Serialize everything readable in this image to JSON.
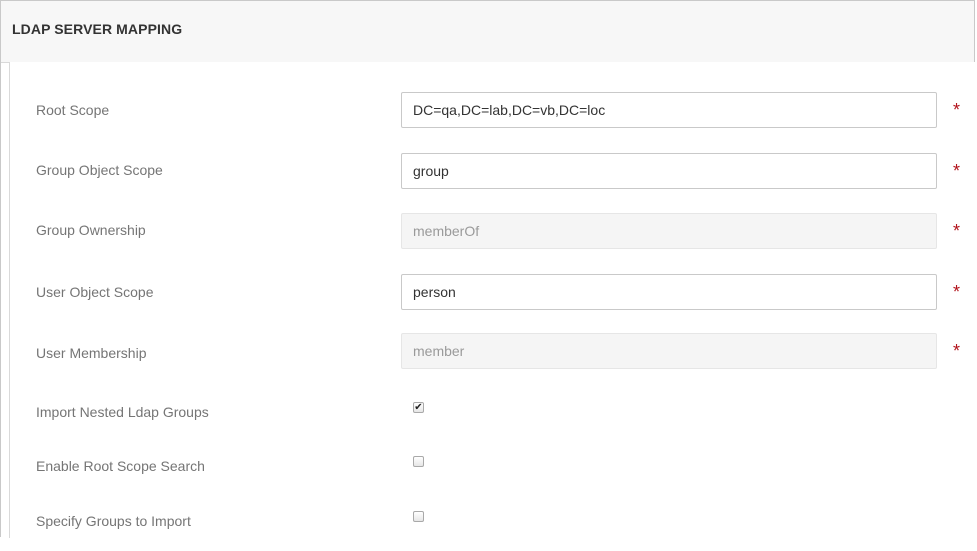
{
  "panel": {
    "title": "LDAP SERVER MAPPING"
  },
  "fields": [
    {
      "label": "Root Scope",
      "value": "DC=qa,DC=lab,DC=vb,DC=loc",
      "editable": true,
      "required_mark": "*"
    },
    {
      "label": "Group Object Scope",
      "value": "group",
      "editable": true,
      "required_mark": "*"
    },
    {
      "label": "Group Ownership",
      "value": "memberOf",
      "editable": false,
      "required_mark": "*"
    },
    {
      "label": "User Object Scope",
      "value": "person",
      "editable": true,
      "required_mark": "*"
    },
    {
      "label": "User Membership",
      "value": "member",
      "editable": false,
      "required_mark": "*"
    }
  ],
  "checkboxes": [
    {
      "label": "Import Nested Ldap Groups",
      "checked": true
    },
    {
      "label": "Enable Root Scope Search",
      "checked": false
    },
    {
      "label": "Specify Groups to Import",
      "checked": false
    }
  ],
  "colors": {
    "required": "#b2121b",
    "label": "#757575",
    "header_bg": "#f7f7f7"
  }
}
